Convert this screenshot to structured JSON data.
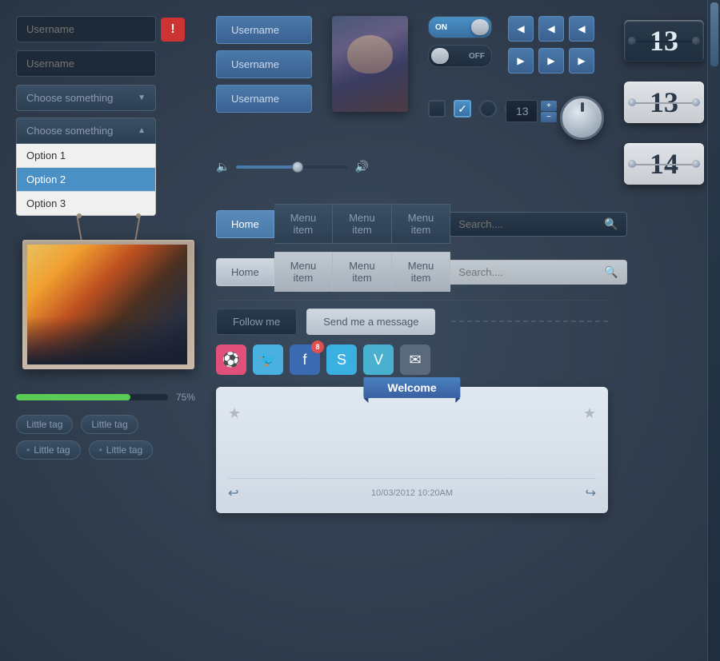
{
  "left": {
    "input1_placeholder": "Username",
    "input2_placeholder": "Username",
    "error_icon": "!",
    "dropdown1_label": "Choose something",
    "dropdown1_arrow": "▼",
    "dropdown_open_label": "Choose something",
    "dropdown_open_arrow": "▲",
    "dropdown_options": [
      {
        "label": "Option 1",
        "selected": false
      },
      {
        "label": "Option 2",
        "selected": true
      },
      {
        "label": "Option 3",
        "selected": false
      }
    ],
    "progress_value": "75%",
    "tags": [
      {
        "label": "Little tag",
        "style": "plain"
      },
      {
        "label": "Little tag",
        "style": "plain"
      },
      {
        "label": "Little tag",
        "style": "dot"
      },
      {
        "label": "Little tag",
        "style": "dot"
      }
    ]
  },
  "mid": {
    "username_btns": [
      "Username",
      "Username",
      "Username"
    ],
    "toggle_on_label": "ON",
    "toggle_off_label": "OFF",
    "stepper_value": "13",
    "nav_items": [
      "Home",
      "Menu item",
      "Menu item",
      "Menu item"
    ],
    "nav_search_placeholder": "Search....",
    "follow_btn": "Follow me",
    "message_btn": "Send me a message",
    "social_icons": [
      "dribbble",
      "twitter",
      "facebook",
      "skype",
      "vimeo",
      "email"
    ],
    "fb_badge": "8",
    "welcome_title": "Welcome",
    "welcome_timestamp": "10/03/2012 10:20AM",
    "dashed_label": ""
  },
  "right": {
    "counters": [
      {
        "value": "13",
        "dark": true
      },
      {
        "value": "13",
        "dark": false
      },
      {
        "value": "14",
        "dark": false
      }
    ]
  }
}
